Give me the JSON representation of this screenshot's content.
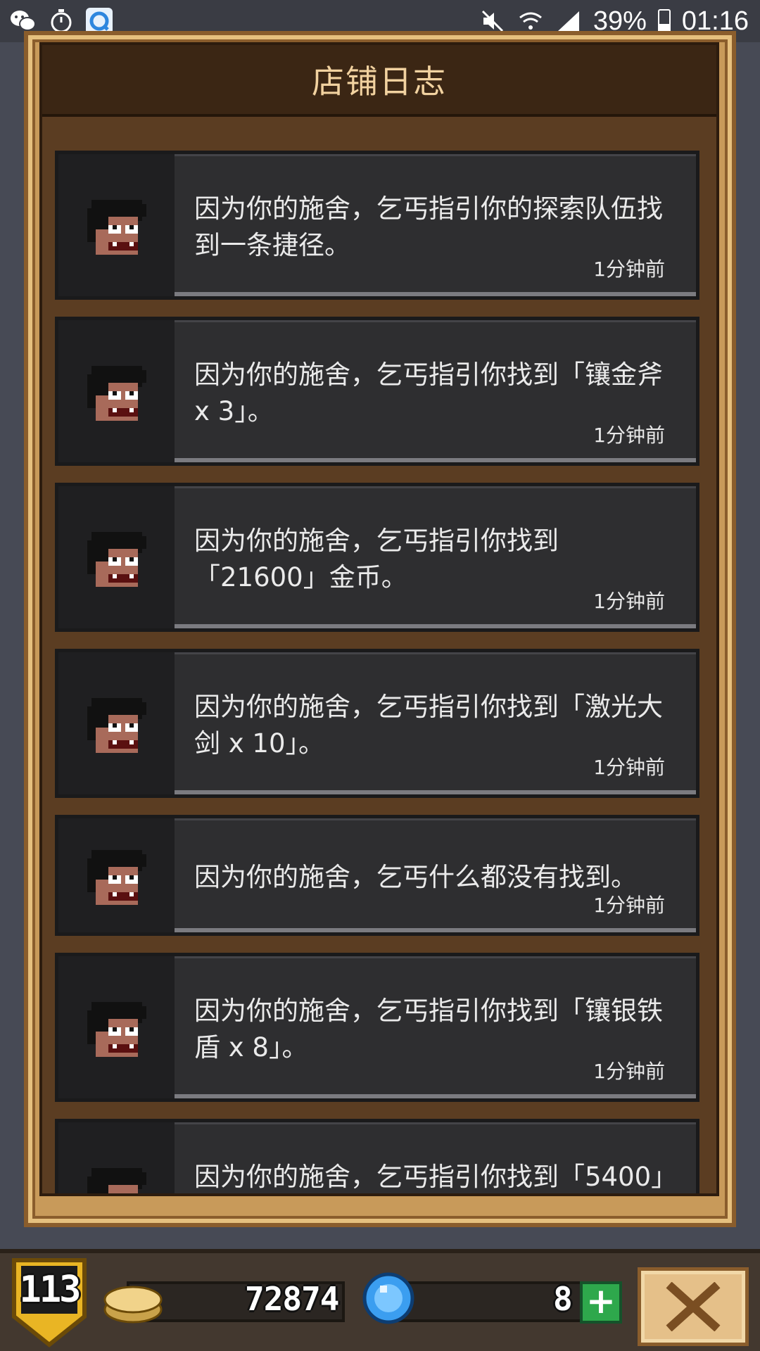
{
  "status_bar": {
    "battery": "39%",
    "time": "01:16",
    "icons": [
      "wechat-icon",
      "stopwatch-icon",
      "browser-app-icon",
      "mute-icon",
      "wifi-icon",
      "signal-icon",
      "battery-icon"
    ]
  },
  "dialog": {
    "title": "店铺日志",
    "entries": [
      {
        "line1": "因为你的施舍，乞丐指引你的探索队伍找",
        "line2": "到一条捷径。",
        "time": "1分钟前"
      },
      {
        "line1": "因为你的施舍，乞丐指引你找到「镶金斧",
        "line2": "x 3」。",
        "time": "1分钟前"
      },
      {
        "line1": "因为你的施舍，乞丐指引你找到",
        "line2": "「21600」金币。",
        "time": "1分钟前"
      },
      {
        "line1": "因为你的施舍，乞丐指引你找到「激光大",
        "line2": "剑 x 10」。",
        "time": "1分钟前"
      },
      {
        "line1": "因为你的施舍，乞丐什么都没有找到。",
        "line2": "",
        "time": "1分钟前"
      },
      {
        "line1": "因为你的施舍，乞丐指引你找到「镶银铁",
        "line2": "盾 x 8」。",
        "time": "1分钟前"
      },
      {
        "line1": "因为你的施舍，乞丐指引你找到「5400」",
        "line2": "",
        "time": ""
      }
    ]
  },
  "footer": {
    "level": "113",
    "gold": "72874",
    "gems": "8",
    "plus_label": "+"
  },
  "colors": {
    "frame": "#c89a5a",
    "card": "#2e2e30",
    "accent_green": "#2ea84c",
    "gem_blue": "#3b9ef0"
  }
}
